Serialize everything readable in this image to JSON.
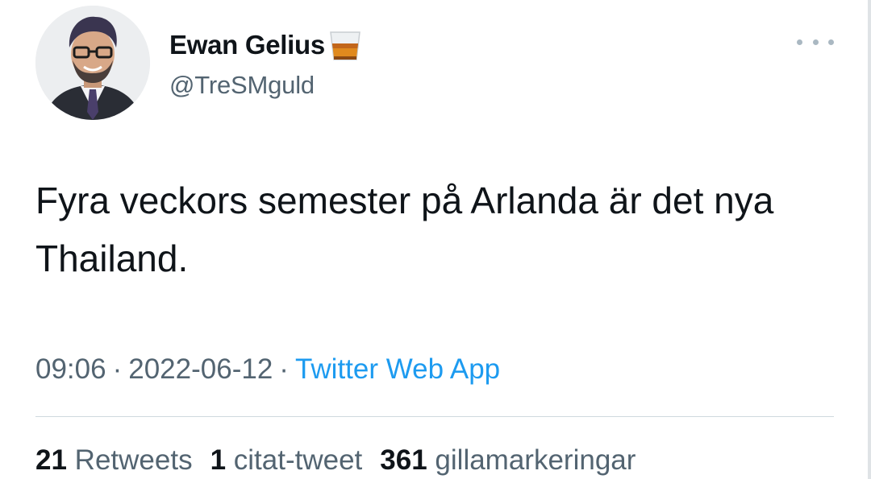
{
  "author": {
    "display_name": "Ewan Gelius",
    "handle": "@TreSMguld",
    "name_emoji_icon": "whisky-glass-icon"
  },
  "tweet": {
    "text": "Fyra veckors semester på Arlanda är det nya Thailand.",
    "time": "09:06",
    "date": "2022-06-12",
    "separator": "·",
    "source": "Twitter Web App"
  },
  "stats": {
    "retweets_count": "21",
    "retweets_label": "Retweets",
    "quotes_count": "1",
    "quotes_label": "citat-tweet",
    "likes_count": "361",
    "likes_label": "gillamarkeringar"
  },
  "colors": {
    "text": "#0f1419",
    "secondary": "#536471",
    "link": "#1d9bf0",
    "divider": "#cfd9de"
  }
}
